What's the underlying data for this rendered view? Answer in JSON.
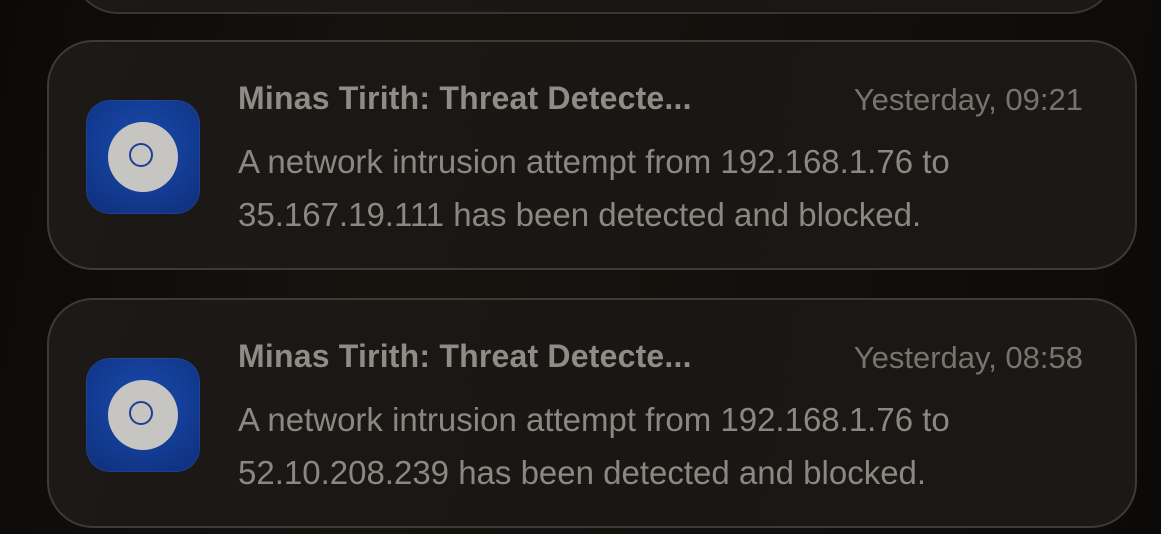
{
  "notifications": [
    {
      "title": "Minas Tirith: Threat Detecte...",
      "time": "Yesterday, 09:21",
      "body_line1": "A network intrusion attempt from 192.168.1.76 to",
      "body_line2": "35.167.19.111 has been detected and blocked.",
      "icon": "app-icon-blue-disc"
    },
    {
      "title": "Minas Tirith: Threat Detecte...",
      "time": "Yesterday, 08:58",
      "body_line1": "A network intrusion attempt from 192.168.1.76 to",
      "body_line2": "52.10.208.239 has been detected and blocked.",
      "icon": "app-icon-blue-disc"
    }
  ],
  "colors": {
    "icon_blue": "#123a90",
    "card_bg": "#1a1714",
    "title_text": "#8f8b86",
    "body_text": "#8b8782",
    "time_text": "#77736e"
  }
}
